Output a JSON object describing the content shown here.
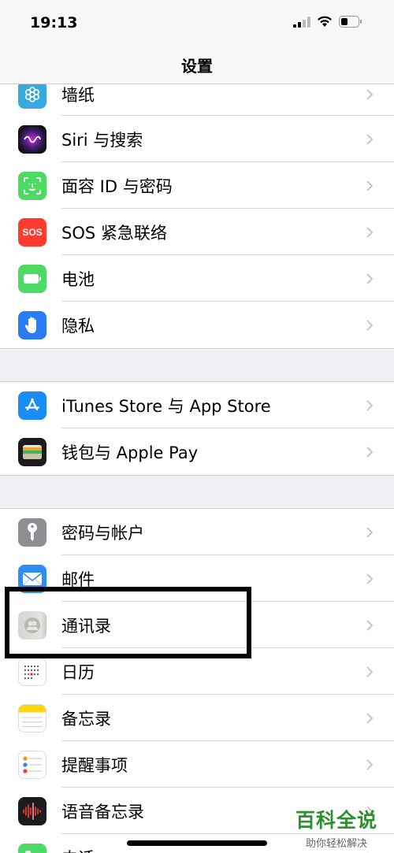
{
  "status_bar": {
    "time": "19:13"
  },
  "nav": {
    "title": "设置"
  },
  "group1": [
    {
      "label": "墙纸",
      "icon": "wallpaper-icon",
      "color": "#36aadc"
    },
    {
      "label": "Siri 与搜索",
      "icon": "siri-icon",
      "color": "#1b1b2e"
    },
    {
      "label": "面容 ID 与密码",
      "icon": "face-id-icon",
      "color": "#4cd964"
    },
    {
      "label": "SOS 紧急联络",
      "icon": "sos-icon",
      "color": "#ff3b30"
    },
    {
      "label": "电池",
      "icon": "battery-icon",
      "color": "#4cd964"
    },
    {
      "label": "隐私",
      "icon": "hand-icon",
      "color": "#2a7cf6"
    }
  ],
  "group2": [
    {
      "label": "iTunes Store 与 App Store",
      "icon": "app-store-icon",
      "color": "#1a8cf5"
    },
    {
      "label": "钱包与 Apple Pay",
      "icon": "wallet-icon",
      "color": "#1c1c1e"
    }
  ],
  "group3": [
    {
      "label": "密码与帐户",
      "icon": "key-icon",
      "color": "#8e8e93"
    },
    {
      "label": "邮件",
      "icon": "mail-icon",
      "color": "#2c8df5"
    },
    {
      "label": "通讯录",
      "icon": "contacts-icon",
      "color": "#cfcfcf"
    },
    {
      "label": "日历",
      "icon": "calendar-icon",
      "color": "#ffffff"
    },
    {
      "label": "备忘录",
      "icon": "notes-icon",
      "color": "#ffd60a"
    },
    {
      "label": "提醒事项",
      "icon": "reminders-icon",
      "color": "#ffffff"
    },
    {
      "label": "语音备忘录",
      "icon": "voice-memos-icon",
      "color": "#1c1c1e"
    },
    {
      "label": "电话",
      "icon": "phone-icon",
      "color": "#4cd964"
    }
  ],
  "watermark": {
    "title": "百科全说",
    "subtitle": "助你轻松解决"
  }
}
